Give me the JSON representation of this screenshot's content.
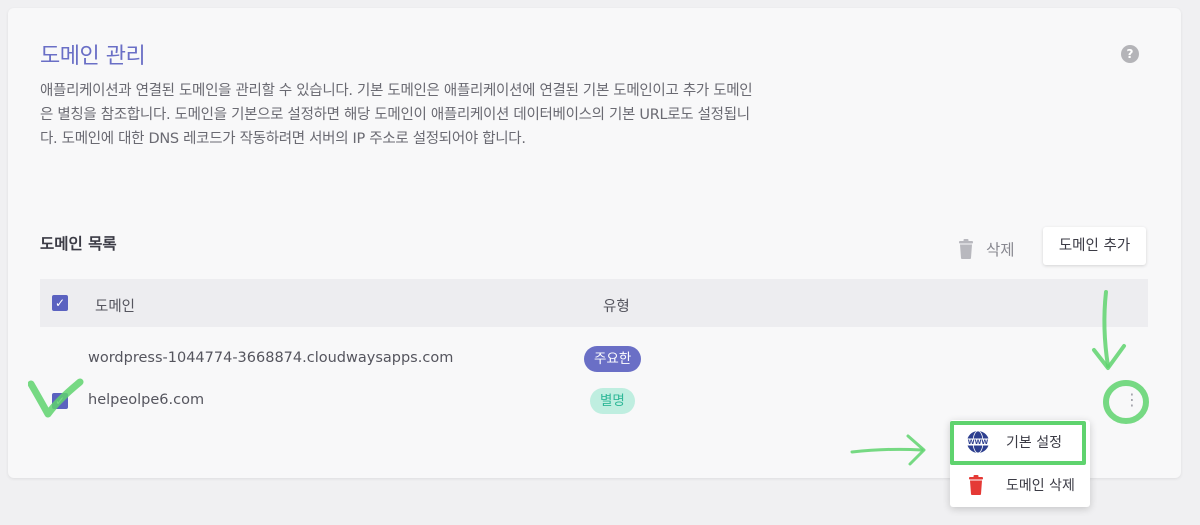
{
  "header": {
    "title": "도메인 관리",
    "help_icon": "question-icon",
    "description": "애플리케이션과 연결된 도메인을 관리할 수 있습니다. 기본 도메인은 애플리케이션에 연결된 기본 도메인이고 추가 도메인은 별칭을 참조합니다. 도메인을 기본으로 설정하면 해당 도메인이 애플리케이션 데이터베이스의 기본 URL로도 설정됩니다. 도메인에 대한 DNS 레코드가 작동하려면 서버의 IP 주소로 설정되어야 합니다."
  },
  "list": {
    "title": "도메인 목록",
    "delete_label": "삭제",
    "add_label": "도메인 추가",
    "columns": {
      "domain": "도메인",
      "type": "유형"
    },
    "rows": [
      {
        "domain": "wordpress-1044774-3668874.cloudwaysapps.com",
        "type": "주요한",
        "checked": false
      },
      {
        "domain": "helpeolpe6.com",
        "type": "별명",
        "checked": true
      }
    ]
  },
  "menu": {
    "items": [
      {
        "label": "기본 설정",
        "icon": "www-icon"
      },
      {
        "label": "도메인 삭제",
        "icon": "trash-icon"
      }
    ]
  },
  "colors": {
    "accent": "#6a6fc6",
    "checkbox": "#5b62c0",
    "badge_primary_bg": "#6a6fc6",
    "badge_alias_bg": "#bfeee0",
    "badge_alias_text": "#2fb898",
    "annotation_green": "#5fd36e",
    "danger": "#e53935"
  }
}
